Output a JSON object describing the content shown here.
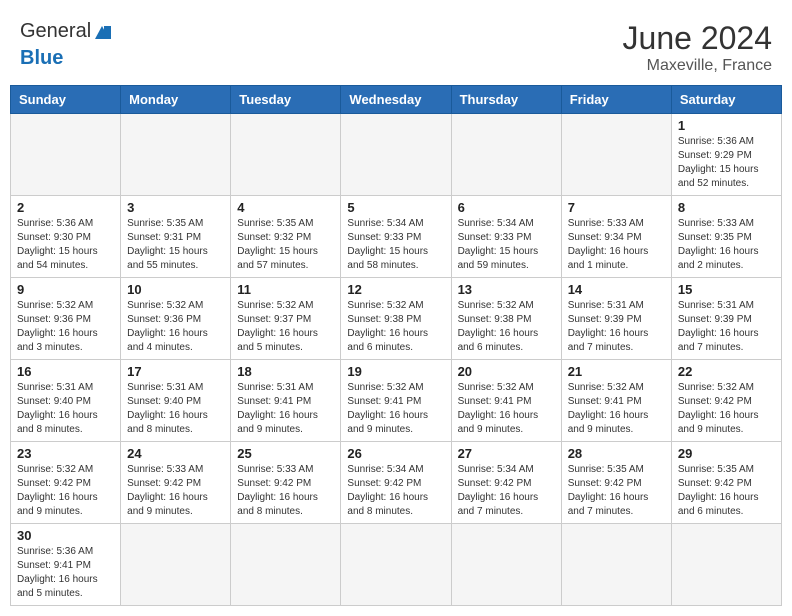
{
  "header": {
    "logo_general": "General",
    "logo_blue": "Blue",
    "month_year": "June 2024",
    "location": "Maxeville, France"
  },
  "days_of_week": [
    "Sunday",
    "Monday",
    "Tuesday",
    "Wednesday",
    "Thursday",
    "Friday",
    "Saturday"
  ],
  "weeks": [
    [
      {
        "day": "",
        "info": ""
      },
      {
        "day": "",
        "info": ""
      },
      {
        "day": "",
        "info": ""
      },
      {
        "day": "",
        "info": ""
      },
      {
        "day": "",
        "info": ""
      },
      {
        "day": "",
        "info": ""
      },
      {
        "day": "1",
        "info": "Sunrise: 5:36 AM\nSunset: 9:29 PM\nDaylight: 15 hours\nand 52 minutes."
      }
    ],
    [
      {
        "day": "2",
        "info": "Sunrise: 5:36 AM\nSunset: 9:30 PM\nDaylight: 15 hours\nand 54 minutes."
      },
      {
        "day": "3",
        "info": "Sunrise: 5:35 AM\nSunset: 9:31 PM\nDaylight: 15 hours\nand 55 minutes."
      },
      {
        "day": "4",
        "info": "Sunrise: 5:35 AM\nSunset: 9:32 PM\nDaylight: 15 hours\nand 57 minutes."
      },
      {
        "day": "5",
        "info": "Sunrise: 5:34 AM\nSunset: 9:33 PM\nDaylight: 15 hours\nand 58 minutes."
      },
      {
        "day": "6",
        "info": "Sunrise: 5:34 AM\nSunset: 9:33 PM\nDaylight: 15 hours\nand 59 minutes."
      },
      {
        "day": "7",
        "info": "Sunrise: 5:33 AM\nSunset: 9:34 PM\nDaylight: 16 hours\nand 1 minute."
      },
      {
        "day": "8",
        "info": "Sunrise: 5:33 AM\nSunset: 9:35 PM\nDaylight: 16 hours\nand 2 minutes."
      }
    ],
    [
      {
        "day": "9",
        "info": "Sunrise: 5:32 AM\nSunset: 9:36 PM\nDaylight: 16 hours\nand 3 minutes."
      },
      {
        "day": "10",
        "info": "Sunrise: 5:32 AM\nSunset: 9:36 PM\nDaylight: 16 hours\nand 4 minutes."
      },
      {
        "day": "11",
        "info": "Sunrise: 5:32 AM\nSunset: 9:37 PM\nDaylight: 16 hours\nand 5 minutes."
      },
      {
        "day": "12",
        "info": "Sunrise: 5:32 AM\nSunset: 9:38 PM\nDaylight: 16 hours\nand 6 minutes."
      },
      {
        "day": "13",
        "info": "Sunrise: 5:32 AM\nSunset: 9:38 PM\nDaylight: 16 hours\nand 6 minutes."
      },
      {
        "day": "14",
        "info": "Sunrise: 5:31 AM\nSunset: 9:39 PM\nDaylight: 16 hours\nand 7 minutes."
      },
      {
        "day": "15",
        "info": "Sunrise: 5:31 AM\nSunset: 9:39 PM\nDaylight: 16 hours\nand 7 minutes."
      }
    ],
    [
      {
        "day": "16",
        "info": "Sunrise: 5:31 AM\nSunset: 9:40 PM\nDaylight: 16 hours\nand 8 minutes."
      },
      {
        "day": "17",
        "info": "Sunrise: 5:31 AM\nSunset: 9:40 PM\nDaylight: 16 hours\nand 8 minutes."
      },
      {
        "day": "18",
        "info": "Sunrise: 5:31 AM\nSunset: 9:41 PM\nDaylight: 16 hours\nand 9 minutes."
      },
      {
        "day": "19",
        "info": "Sunrise: 5:32 AM\nSunset: 9:41 PM\nDaylight: 16 hours\nand 9 minutes."
      },
      {
        "day": "20",
        "info": "Sunrise: 5:32 AM\nSunset: 9:41 PM\nDaylight: 16 hours\nand 9 minutes."
      },
      {
        "day": "21",
        "info": "Sunrise: 5:32 AM\nSunset: 9:41 PM\nDaylight: 16 hours\nand 9 minutes."
      },
      {
        "day": "22",
        "info": "Sunrise: 5:32 AM\nSunset: 9:42 PM\nDaylight: 16 hours\nand 9 minutes."
      }
    ],
    [
      {
        "day": "23",
        "info": "Sunrise: 5:32 AM\nSunset: 9:42 PM\nDaylight: 16 hours\nand 9 minutes."
      },
      {
        "day": "24",
        "info": "Sunrise: 5:33 AM\nSunset: 9:42 PM\nDaylight: 16 hours\nand 9 minutes."
      },
      {
        "day": "25",
        "info": "Sunrise: 5:33 AM\nSunset: 9:42 PM\nDaylight: 16 hours\nand 8 minutes."
      },
      {
        "day": "26",
        "info": "Sunrise: 5:34 AM\nSunset: 9:42 PM\nDaylight: 16 hours\nand 8 minutes."
      },
      {
        "day": "27",
        "info": "Sunrise: 5:34 AM\nSunset: 9:42 PM\nDaylight: 16 hours\nand 7 minutes."
      },
      {
        "day": "28",
        "info": "Sunrise: 5:35 AM\nSunset: 9:42 PM\nDaylight: 16 hours\nand 7 minutes."
      },
      {
        "day": "29",
        "info": "Sunrise: 5:35 AM\nSunset: 9:42 PM\nDaylight: 16 hours\nand 6 minutes."
      }
    ],
    [
      {
        "day": "30",
        "info": "Sunrise: 5:36 AM\nSunset: 9:41 PM\nDaylight: 16 hours\nand 5 minutes."
      },
      {
        "day": "",
        "info": ""
      },
      {
        "day": "",
        "info": ""
      },
      {
        "day": "",
        "info": ""
      },
      {
        "day": "",
        "info": ""
      },
      {
        "day": "",
        "info": ""
      },
      {
        "day": "",
        "info": ""
      }
    ]
  ]
}
